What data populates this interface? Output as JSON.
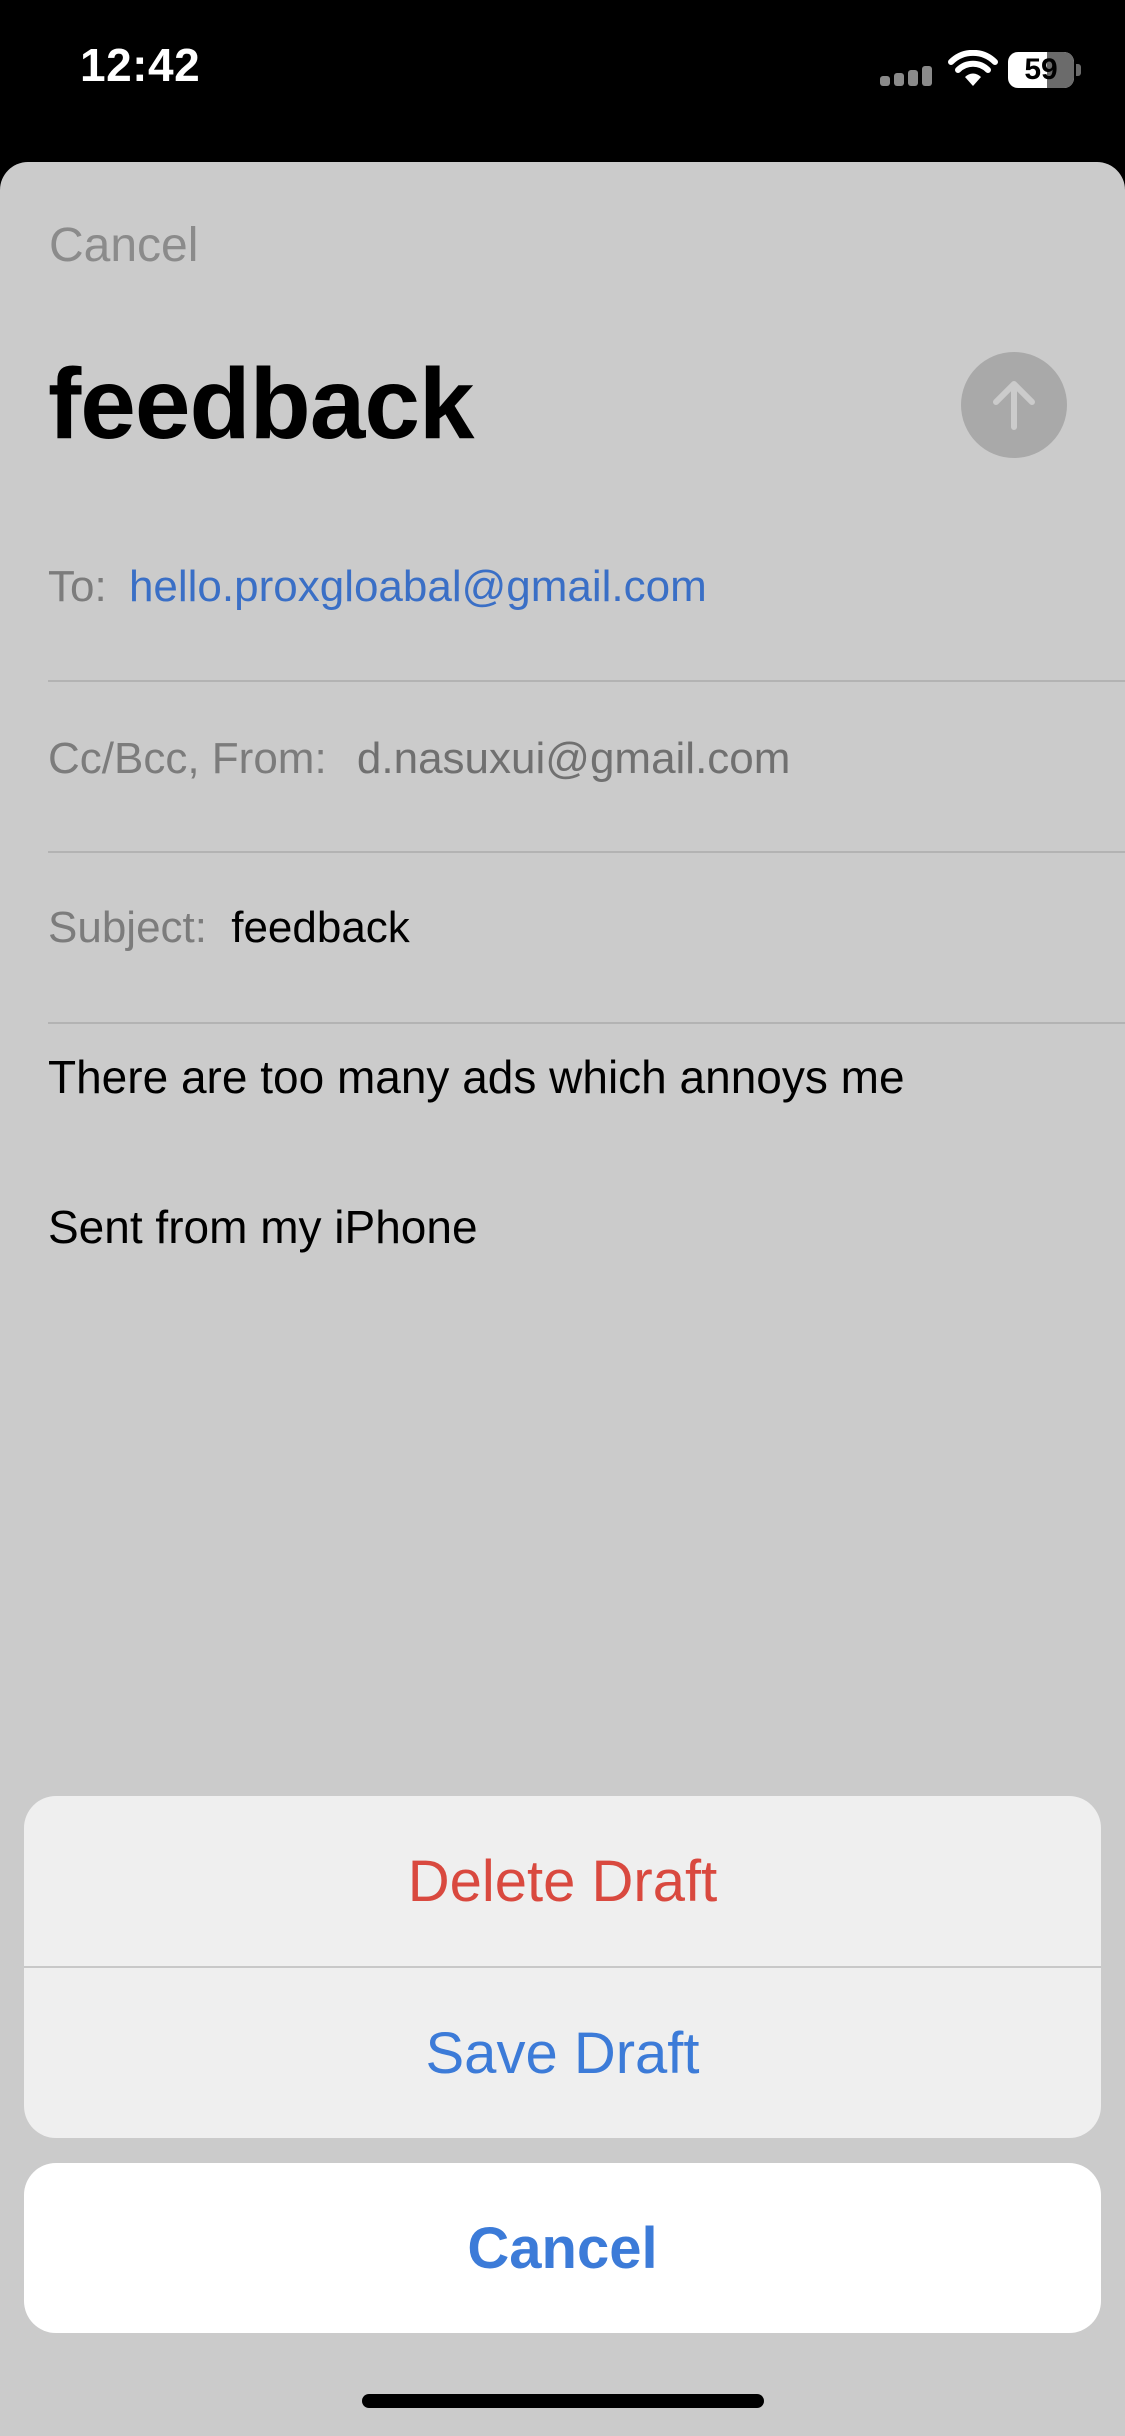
{
  "status_bar": {
    "time": "12:42",
    "battery_level": "59",
    "battery_fraction": 0.59,
    "icons": [
      "cellular-signal-icon",
      "wifi-icon",
      "battery-icon"
    ]
  },
  "compose": {
    "cancel_label": "Cancel",
    "title": "feedback",
    "send_icon": "arrow-up-icon",
    "to_label": "To:",
    "to_value": "hello.proxgloabal@gmail.com",
    "ccbcc_label": "Cc/Bcc, From:",
    "from_value": "d.nasuxui@gmail.com",
    "subject_label": "Subject:",
    "subject_value": "feedback",
    "body": "There are too many ads which annoys me",
    "signature": "Sent from my iPhone"
  },
  "action_sheet": {
    "delete_label": "Delete Draft",
    "save_label": "Save Draft",
    "cancel_label": "Cancel"
  },
  "colors": {
    "destructive": "#d9493f",
    "accent": "#3c7bd8",
    "link": "#3a6fc6"
  }
}
